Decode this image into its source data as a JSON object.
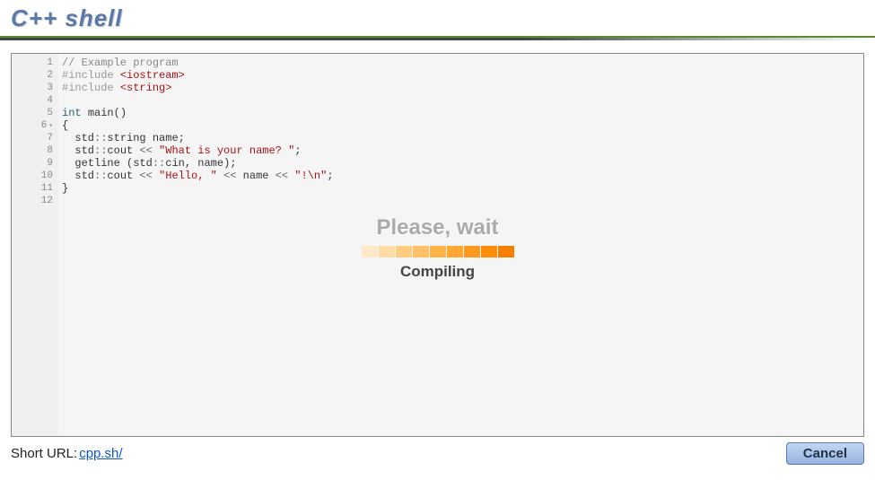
{
  "header": {
    "title": "C++ shell"
  },
  "editor": {
    "lines": [
      {
        "n": "1",
        "fold": false,
        "cls": "comment",
        "raw": "// Example program"
      },
      {
        "n": "2",
        "fold": false,
        "cls": "include",
        "raw": "#include <iostream>"
      },
      {
        "n": "3",
        "fold": false,
        "cls": "include",
        "raw": "#include <string>"
      },
      {
        "n": "4",
        "fold": false,
        "cls": "blank",
        "raw": ""
      },
      {
        "n": "5",
        "fold": false,
        "cls": "decl",
        "raw": "int main()"
      },
      {
        "n": "6",
        "fold": true,
        "cls": "brace",
        "raw": "{"
      },
      {
        "n": "7",
        "fold": false,
        "cls": "stmt",
        "raw": "  std::string name;"
      },
      {
        "n": "8",
        "fold": false,
        "cls": "io",
        "raw": "  std::cout << \"What is your name? \";"
      },
      {
        "n": "9",
        "fold": false,
        "cls": "stmt",
        "raw": "  getline (std::cin, name);"
      },
      {
        "n": "10",
        "fold": false,
        "cls": "io2",
        "raw": "  std::cout << \"Hello, \" << name << \"!\\n\";"
      },
      {
        "n": "11",
        "fold": false,
        "cls": "brace",
        "raw": "}"
      },
      {
        "n": "12",
        "fold": false,
        "cls": "blank",
        "raw": ""
      }
    ]
  },
  "overlay": {
    "wait_text": "Please, wait",
    "status_text": "Compiling",
    "colors": [
      "#ffe9c9",
      "#ffdba6",
      "#ffcc80",
      "#ffc066",
      "#ffb347",
      "#ffa733",
      "#ff9a1f",
      "#ff8c0a",
      "#f57f00"
    ]
  },
  "footer": {
    "short_label": "Short URL: ",
    "short_url": "cpp.sh/",
    "cancel_label": "Cancel"
  }
}
